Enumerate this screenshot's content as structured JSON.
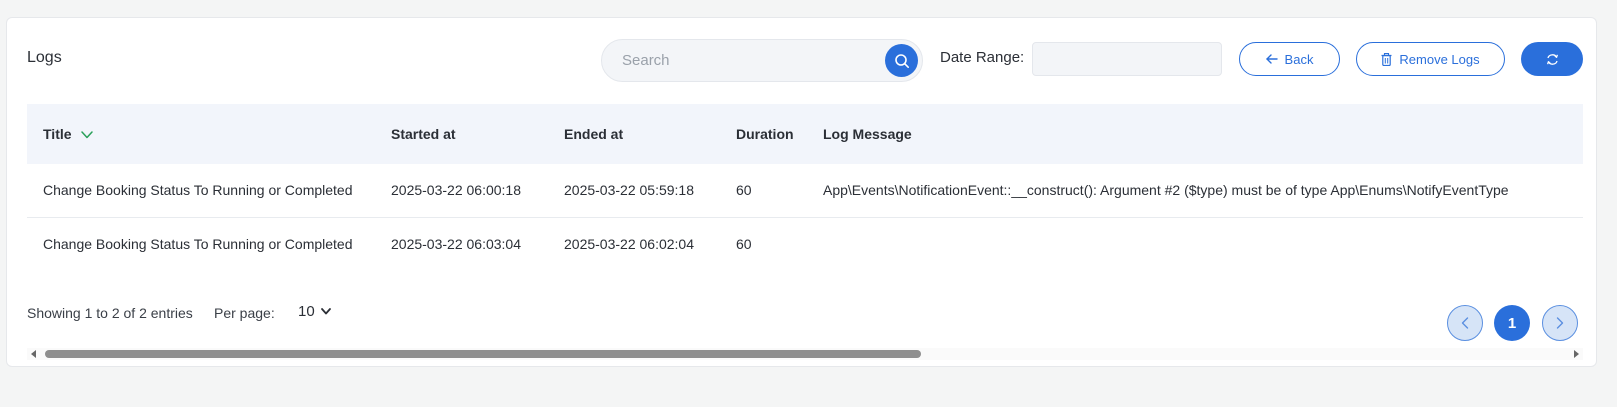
{
  "header": {
    "title": "Logs",
    "search_placeholder": "Search",
    "date_range_label": "Date Range:",
    "date_range_value": "",
    "back_label": "Back",
    "remove_logs_label": "Remove Logs"
  },
  "colors": {
    "accent": "#2a6fdb",
    "sort_indicator": "#2aa05a",
    "header_row_bg": "#f2f5fb"
  },
  "icons": {
    "search": "search-icon",
    "back": "arrow-left-icon",
    "remove": "trash-icon",
    "refresh": "refresh-icon",
    "sort": "chevron-down-icon",
    "prev": "chevron-left-icon",
    "next": "chevron-right-icon"
  },
  "table": {
    "columns": [
      "Title",
      "Started at",
      "Ended at",
      "Duration",
      "Log Message"
    ],
    "sorted_column": "Title",
    "rows": [
      {
        "title": "Change Booking Status To Running or Completed",
        "started_at": "2025-03-22 06:00:18",
        "ended_at": "2025-03-22 05:59:18",
        "duration": "60",
        "log_message": "App\\Events\\NotificationEvent::__construct(): Argument #2 ($type) must be of type App\\Enums\\NotifyEventType"
      },
      {
        "title": "Change Booking Status To Running or Completed",
        "started_at": "2025-03-22 06:03:04",
        "ended_at": "2025-03-22 06:02:04",
        "duration": "60",
        "log_message": ""
      }
    ]
  },
  "footer": {
    "showing_text": "Showing 1 to 2 of 2 entries",
    "per_page_label": "Per page:",
    "per_page_value": "10",
    "current_page": "1"
  }
}
